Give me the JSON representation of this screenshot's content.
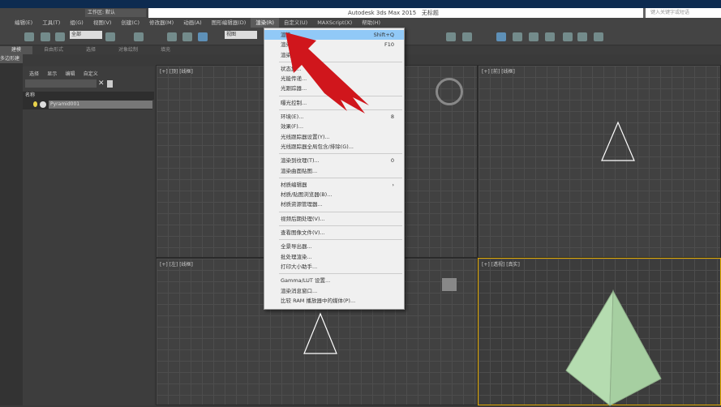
{
  "title": {
    "app": "Autodesk 3ds Max  2015",
    "doc": "无标题",
    "search_placeholder": "键入关键字或短语",
    "workspace": "工作区: 默认"
  },
  "menubar": [
    "编辑(E)",
    "工具(T)",
    "组(G)",
    "视图(V)",
    "创建(C)",
    "修改器(M)",
    "动画(A)",
    "图形编辑器(D)",
    "渲染(R)",
    "自定义(U)",
    "MAXScript(X)",
    "帮助(H)"
  ],
  "toolbar": {
    "selection_filter": "全部",
    "ref_coord": "视图"
  },
  "ribbon": {
    "tabs": [
      "建模",
      "自由形式",
      "选择",
      "对象绘制",
      "填充"
    ],
    "panel_label": "多边形建模"
  },
  "explorer": {
    "tabs": [
      "选择",
      "显示",
      "编辑",
      "自定义"
    ],
    "column": "名称",
    "items": [
      "Pyramid001"
    ]
  },
  "viewports": [
    {
      "label": "[+] [顶] [线框]"
    },
    {
      "label": "[+] [前] [线框]"
    },
    {
      "label": "[+] [左] [线框]"
    },
    {
      "label": "[+] [透视] [真实]"
    }
  ],
  "render_menu": {
    "groups": [
      [
        {
          "label": "渲染",
          "shortcut": "Shift+Q"
        },
        {
          "label": "渲染设",
          "shortcut": "F10"
        },
        {
          "label": "渲染帧",
          "shortcut": ""
        }
      ],
      [
        {
          "label": "状态集...",
          "shortcut": ""
        },
        {
          "label": "光能传递...",
          "shortcut": ""
        },
        {
          "label": "光跟踪器...",
          "shortcut": ""
        }
      ],
      [
        {
          "label": "曝光控制...",
          "shortcut": ""
        }
      ],
      [
        {
          "label": "环境(E)...",
          "shortcut": "8"
        },
        {
          "label": "效果(F)...",
          "shortcut": ""
        },
        {
          "label": "光线跟踪器设置(Y)...",
          "shortcut": ""
        },
        {
          "label": "光线跟踪器全局包含/排除(G)...",
          "shortcut": ""
        }
      ],
      [
        {
          "label": "渲染到纹理(T)...",
          "shortcut": "0"
        },
        {
          "label": "渲染曲面贴图...",
          "shortcut": ""
        }
      ],
      [
        {
          "label": "材质编辑器",
          "shortcut": "›"
        },
        {
          "label": "材质/贴图浏览器(B)...",
          "shortcut": ""
        },
        {
          "label": "材质资源管理器...",
          "shortcut": ""
        }
      ],
      [
        {
          "label": "视频后期处理(V)...",
          "shortcut": ""
        }
      ],
      [
        {
          "label": "查看图像文件(V)...",
          "shortcut": ""
        }
      ],
      [
        {
          "label": "全景导出器...",
          "shortcut": ""
        },
        {
          "label": "批处理渲染...",
          "shortcut": ""
        },
        {
          "label": "打印大小助手...",
          "shortcut": ""
        }
      ],
      [
        {
          "label": "Gamma/LUT 设置...",
          "shortcut": ""
        },
        {
          "label": "渲染消息窗口...",
          "shortcut": ""
        },
        {
          "label": "比较 RAM 播放器中的媒体(P)...",
          "shortcut": ""
        }
      ]
    ]
  },
  "colors": {
    "title_bar": "#0d2b50",
    "menu_highlight": "#91c9f7",
    "arrow": "#d0161c",
    "pyramid": "#b5dcb0"
  }
}
